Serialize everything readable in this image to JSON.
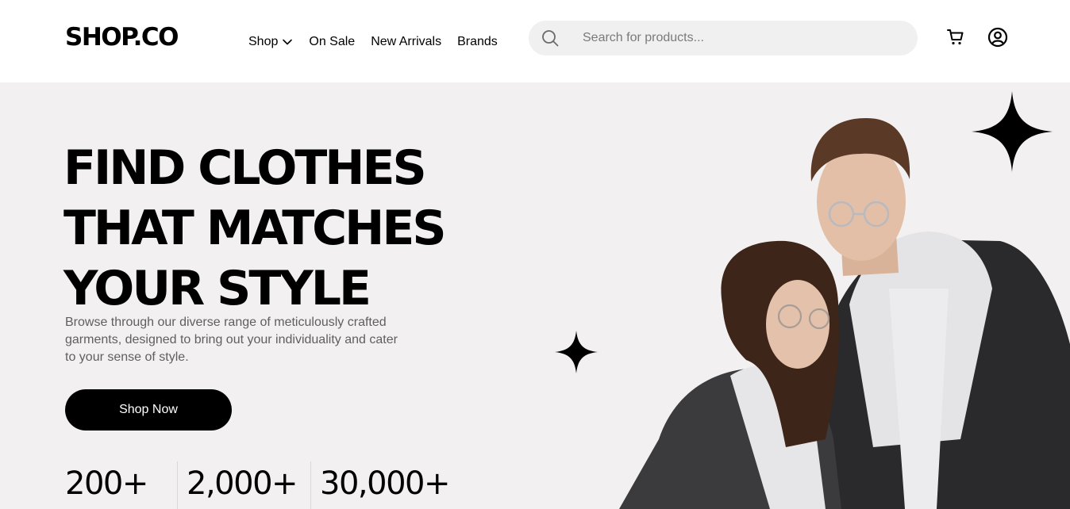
{
  "header": {
    "logo": "SHOP.CO",
    "nav": [
      {
        "label": "Shop",
        "has_dropdown": true
      },
      {
        "label": "On Sale"
      },
      {
        "label": "New Arrivals"
      },
      {
        "label": "Brands"
      }
    ],
    "search": {
      "placeholder": "Search for products...",
      "value": "",
      "icon": "search-icon"
    },
    "icons": [
      "cart-icon",
      "account-icon"
    ]
  },
  "hero": {
    "title_lines": [
      "FIND CLOTHES",
      "THAT MATCHES",
      "YOUR STYLE"
    ],
    "subtitle": "Browse through our diverse range of meticulously crafted garments, designed to bring out your individuality and cater to your sense of style.",
    "cta": "Shop Now",
    "stats": [
      "200+",
      "2,000+",
      "30,000+"
    ],
    "colors": {
      "background": "#f2f0f1",
      "accent": "#000000",
      "text_muted": "#5f5f5f"
    }
  }
}
